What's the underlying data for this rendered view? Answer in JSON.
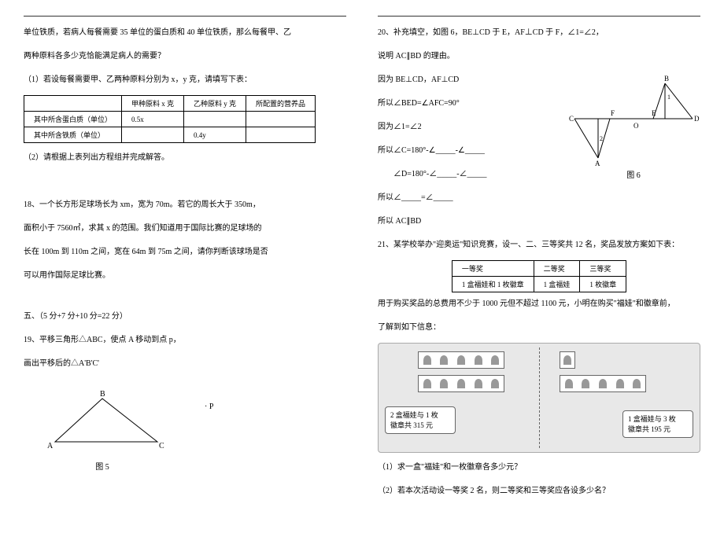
{
  "left": {
    "intro1": "单位铁质，若病人每餐需要 35 单位的蛋白质和 40 单位铁质，那么每餐甲、乙",
    "intro2": "两种原料各多少克恰能满足病人的需要？",
    "sub1": "（1）若设每餐需要甲、乙两种原料分别为 x，y 克，请填写下表：",
    "table": {
      "h1": "",
      "h2": "甲种原料 x 克",
      "h3": "乙种原料 y 克",
      "h4": "所配置的营养品",
      "r1c1": "其中所含蛋白质（单位）",
      "r1c2": "0.5x",
      "r1c3": "",
      "r1c4": "",
      "r2c1": "其中所含铁质（单位）",
      "r2c2": "",
      "r2c3": "0.4y",
      "r2c4": ""
    },
    "sub2": "（2）请根据上表列出方程组并完成解答。",
    "q18a": "18、一个长方形足球场长为 xm，宽为 70m。若它的周长大于 350m，",
    "q18b": "面积小于 7560㎡，求其 x 的范围。我们知道用于国际比赛的足球场的",
    "q18c": "长在 100m 到 110m 之间，宽在 64m 到 75m 之间，请你判断该球场是否",
    "q18d": "可以用作国际足球比赛。",
    "section5": "五、（5 分+7 分+10 分=22 分）",
    "q19a": "19、平移三角形△ABC，使点 A 移动到点 p，",
    "q19b": "画出平移后的△A'B'C'",
    "point_p": "· P",
    "fig5": "图 5",
    "tri": {
      "a": "A",
      "b": "B",
      "c": "C"
    }
  },
  "right": {
    "q20a": "20、补充填空，如图 6，BE⊥CD 于 E，AF⊥CD 于 F，∠1=∠2，",
    "q20b": "说明 AC∥BD 的理由。",
    "q20c": "因为 BE⊥CD，AF⊥CD",
    "q20d": "所以∠BED=∠AFC=90°",
    "q20e": "因为∠1=∠2",
    "q20f": "所以∠C=180°-∠_____-∠_____",
    "q20g": "　　∠D=180°-∠_____-∠_____",
    "q20h": "所以∠_____=∠_____",
    "q20i": "所以 AC∥BD",
    "fig6": "图 6",
    "geo": {
      "a": "A",
      "b": "B",
      "c": "C",
      "d": "D",
      "e": "E",
      "f": "F",
      "o": "O",
      "one": "1",
      "two": "2"
    },
    "q21a": "21、某学校举办\"迎奥运\"知识竞赛，设一、二、三等奖共 12 名，奖品发放方案如下表：",
    "prize_table": {
      "h1": "一等奖",
      "h2": "二等奖",
      "h3": "三等奖",
      "r1": "1 盒福娃和 1 枚徽章",
      "r2": "1 盒福娃",
      "r3": "1 枚徽章"
    },
    "q21b": "用于购买奖品的总费用不少于 1000 元但不超过 1100 元，小明在购买\"福娃\"和徽章前，",
    "q21c": "了解到如下信息：",
    "speech1a": "2 盒福娃与 1 枚",
    "speech1b": "徽章共 315 元",
    "speech2a": "1 盒福娃与 3 枚",
    "speech2b": "徽章共 195 元",
    "q21d": "（1）求一盒\"福娃\"和一枚徽章各多少元？",
    "q21e": "（2）若本次活动设一等奖 2 名，则二等奖和三等奖应各设多少名？"
  }
}
